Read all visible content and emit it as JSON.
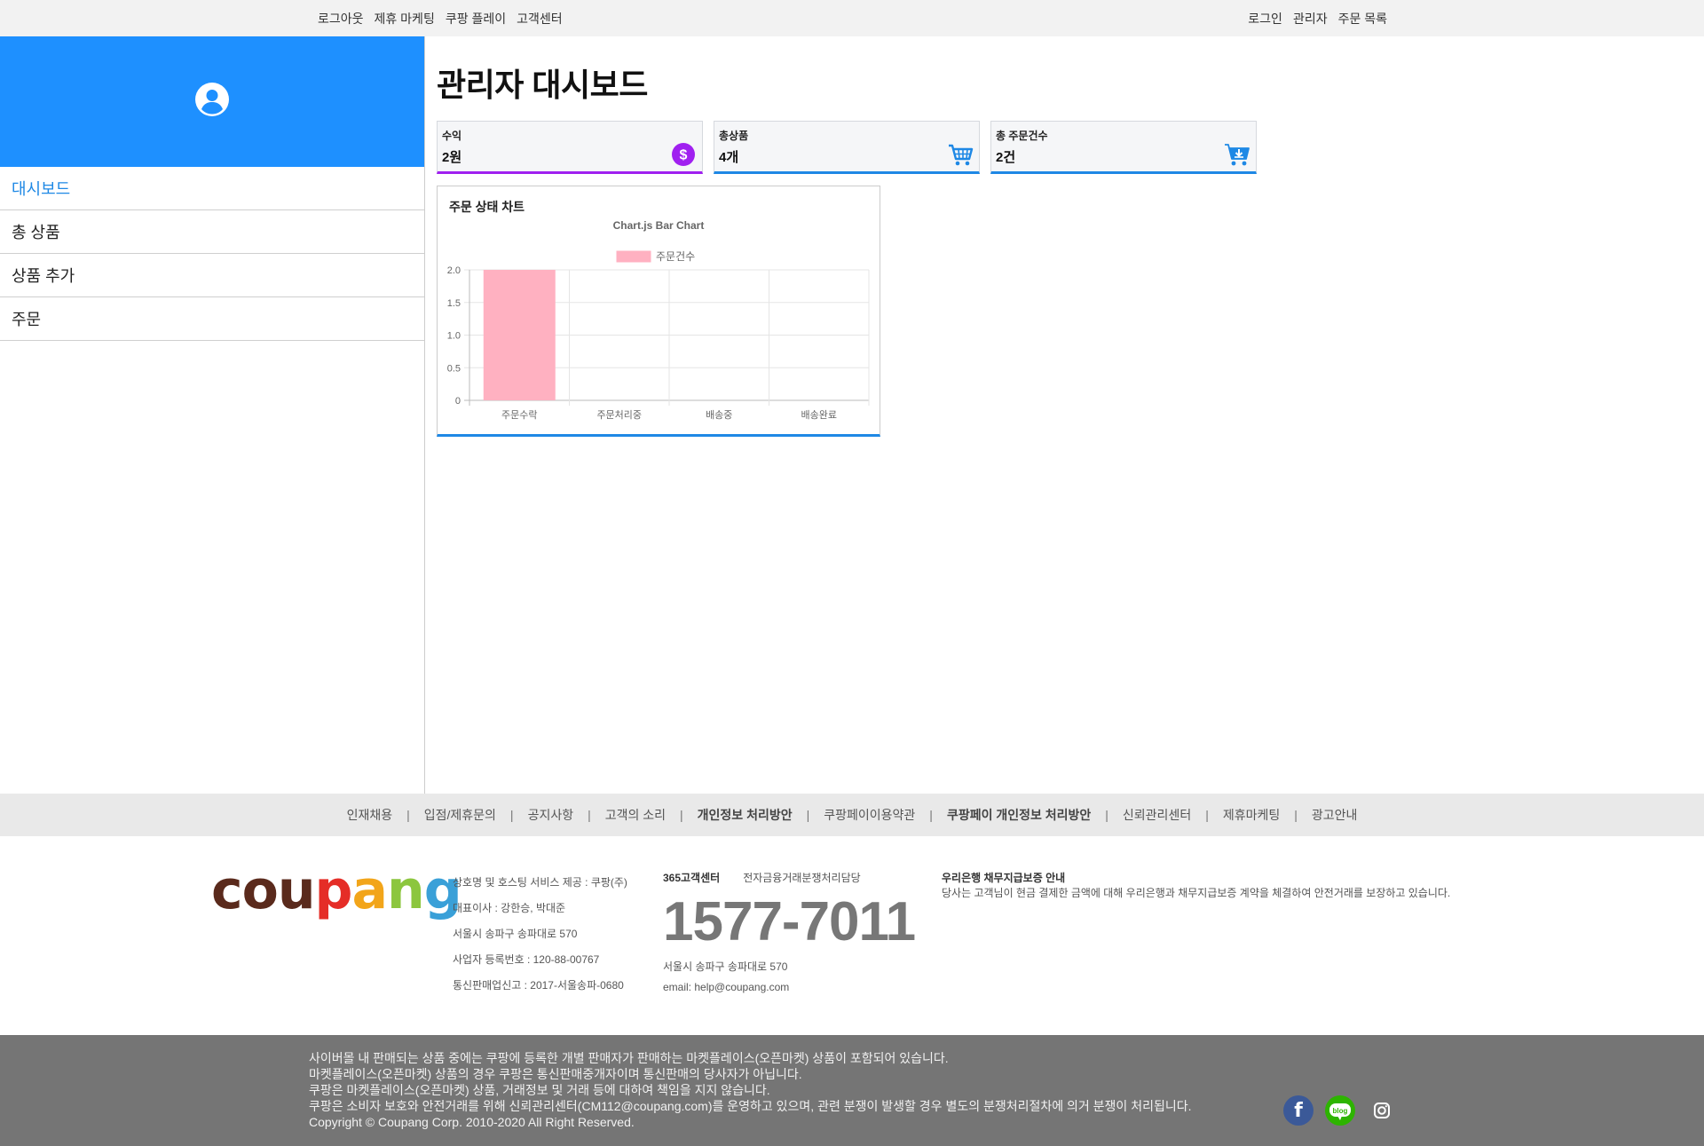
{
  "topnav": {
    "left": [
      "로그아웃",
      "제휴 마케팅",
      "쿠팡 플레이",
      "고객센터"
    ],
    "right": [
      "로그인",
      "관리자",
      "주문 목록"
    ]
  },
  "sidebar": {
    "items": [
      {
        "label": "대시보드",
        "active": true
      },
      {
        "label": "총 상품"
      },
      {
        "label": "상품 추가"
      },
      {
        "label": "주문"
      }
    ]
  },
  "main": {
    "title": "관리자 대시보드",
    "cards": [
      {
        "label": "수익",
        "value": "2원",
        "icon": "dollar-icon",
        "color": "#a020f0"
      },
      {
        "label": "총상품",
        "value": "4개",
        "icon": "shopping-cart-icon",
        "color": "#1e88e5"
      },
      {
        "label": "총 주문건수",
        "value": "2건",
        "icon": "cart-download-icon",
        "color": "#1e88e5"
      }
    ],
    "chart_heading": "주문 상태 차트"
  },
  "chart_data": {
    "type": "bar",
    "title": "Chart.js Bar Chart",
    "categories": [
      "주문수락",
      "주문처리중",
      "배송중",
      "배송완료"
    ],
    "series": [
      {
        "name": "주문건수",
        "values": [
          2,
          0,
          0,
          0
        ],
        "color": "#ffb1c1"
      }
    ],
    "ylim": [
      0,
      2
    ],
    "yticks": [
      "2.0",
      "1.5",
      "1.0",
      "0.5",
      "0"
    ],
    "legend": "top",
    "grid": true
  },
  "footer": {
    "links": [
      {
        "label": "인재채용"
      },
      {
        "label": "입점/제휴문의"
      },
      {
        "label": "공지사항"
      },
      {
        "label": "고객의 소리"
      },
      {
        "label": "개인정보 처리방안",
        "bold": true
      },
      {
        "label": "쿠팡페이이용약관"
      },
      {
        "label": "쿠팡페이 개인정보 처리방안",
        "bold": true
      },
      {
        "label": "신뢰관리센터"
      },
      {
        "label": "제휴마케팅"
      },
      {
        "label": "광고안내"
      }
    ],
    "logo": "coupang",
    "company_info": [
      "상호명 및 호스팅 서비스 제공 : 쿠팡(주)",
      "대표이사 : 강한승, 박대준",
      "서울시 송파구 송파대로 570",
      "사업자 등록번호 : 120-88-00767",
      "통신판매업신고 : 2017-서울송파-0680"
    ],
    "cs_title": "365고객센터",
    "cs_sub": "전자금융거래분쟁처리담당",
    "phone": "1577-7011",
    "cs_address": "서울시 송파구 송파대로 570",
    "email": "email: help@coupang.com",
    "bank_title": "우리은행 채무지급보증 안내",
    "bank_text": "당사는 고객님이 현금 결제한 금액에 대해 우리은행과 채무지급보증 계약을 체결하여 안전거래를 보장하고 있습니다.",
    "notice_lines": [
      "사이버몰 내 판매되는 상품 중에는 쿠팡에 등록한 개별 판매자가 판매하는 마켓플레이스(오픈마켓) 상품이 포함되어 있습니다.",
      "마켓플레이스(오픈마켓) 상품의 경우 쿠팡은 통신판매중개자이며 통신판매의 당사자가 아닙니다.",
      "쿠팡은 마켓플레이스(오픈마켓) 상품, 거래정보 및 거래 등에 대하여 책임을 지지 않습니다.",
      "쿠팡은 소비자 보호와 안전거래를 위해 신뢰관리센터(CM112@coupang.com)를 운영하고 있으며, 관련 분쟁이 발생할 경우 별도의 분쟁처리절차에 의거 분쟁이 처리됩니다.",
      "Copyright © Coupang Corp. 2010-2020 All Right Reserved."
    ],
    "social": [
      {
        "icon": "facebook-icon",
        "text": "f"
      },
      {
        "icon": "blog-icon",
        "text": "blog"
      },
      {
        "icon": "instagram-icon"
      }
    ]
  }
}
